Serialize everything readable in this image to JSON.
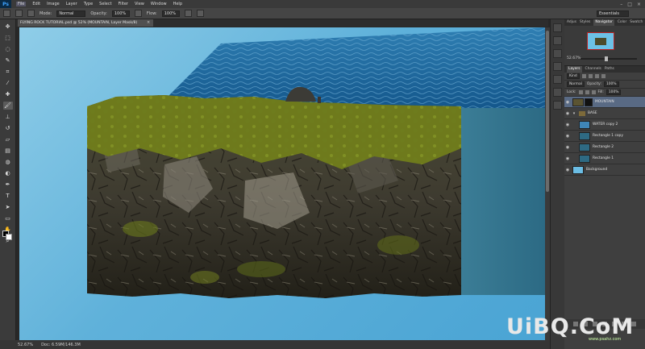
{
  "app": {
    "logo": "Ps",
    "menu": [
      "File",
      "Edit",
      "Image",
      "Layer",
      "Type",
      "Select",
      "Filter",
      "View",
      "Window",
      "Help"
    ],
    "window_controls": [
      "–",
      "□",
      "×"
    ]
  },
  "options_bar": {
    "mode_label": "Mode:",
    "mode_value": "Normal",
    "opacity_label": "Opacity:",
    "opacity_value": "100%",
    "flow_label": "Flow:",
    "flow_value": "100%",
    "workspace": "Essentials"
  },
  "document": {
    "tab_title": "FLYING ROCK TUTORIAL.psd @ 52% (MOUNTAIN, Layer Mask/8)",
    "tab_close": "×"
  },
  "status": {
    "zoom": "52.67%",
    "doc_size": "Doc: 6.59M/146.3M"
  },
  "panels": {
    "top_tabs": [
      "Adjus",
      "Styles",
      "Navigator",
      "Color",
      "Swatch"
    ],
    "navigator_zoom": "52.67%",
    "layer_tabs": [
      "Layers",
      "Channels",
      "Paths"
    ],
    "kind_label": "Kind",
    "blend_mode": "Normal",
    "opacity_label": "Opacity:",
    "opacity_value": "100%",
    "lock_label": "Lock:",
    "fill_label": "Fill:",
    "fill_value": "100%",
    "layers": [
      {
        "name": "MOUNTAIN",
        "selected": true
      },
      {
        "name": "BASE",
        "group": true
      },
      {
        "name": "WATER copy 2"
      },
      {
        "name": "Rectangle 1 copy"
      },
      {
        "name": "Rectangle 2"
      },
      {
        "name": "Rectangle 1"
      },
      {
        "name": "Background"
      }
    ]
  },
  "watermark": {
    "main": "UiBQ.CoM",
    "sub": "www.psahz.com"
  }
}
